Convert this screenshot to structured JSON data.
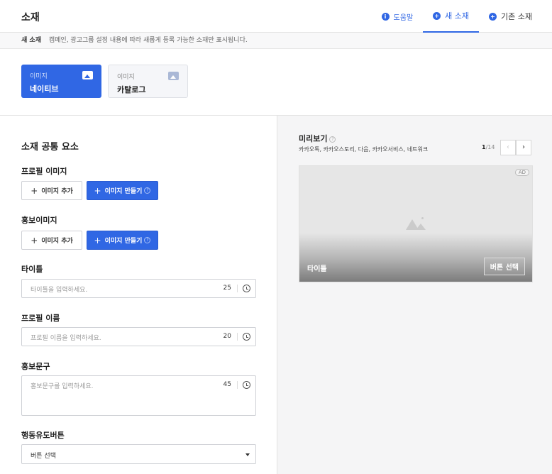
{
  "header": {
    "title": "소재",
    "tabs": [
      {
        "label": "도움말"
      },
      {
        "label": "새 소재"
      },
      {
        "label": "기존 소재"
      }
    ]
  },
  "subbar": {
    "title": "새 소재",
    "desc": "캠페인, 광고그룹 설정 내용에 따라 새롭게 등록 가능한 소재만 표시됩니다."
  },
  "types": [
    {
      "caption": "이미지",
      "name": "네이티브",
      "selected": true
    },
    {
      "caption": "이미지",
      "name": "카탈로그",
      "selected": false
    }
  ],
  "form": {
    "section_title": "소재 공통 요소",
    "profile_image": {
      "label": "프로필 이미지",
      "add": "이미지 추가",
      "create": "이미지 만들기"
    },
    "promo_image": {
      "label": "홍보이미지",
      "add": "이미지 추가",
      "create": "이미지 만들기"
    },
    "title": {
      "label": "타이틀",
      "placeholder": "타이틀을 입력하세요.",
      "max": "25"
    },
    "profile_name": {
      "label": "프로필 이름",
      "placeholder": "프로필 이름을 입력하세요.",
      "max": "20"
    },
    "promo_text": {
      "label": "홍보문구",
      "placeholder": "홍보문구를 입력하세요.",
      "max": "45"
    },
    "cta": {
      "label": "행동유도버튼",
      "value": "버튼 선택"
    }
  },
  "preview": {
    "title": "미리보기",
    "platforms": "카카오톡, 카카오스토리, 다음, 카카오서비스, 네트워크",
    "page_current": "1",
    "page_total": "/14",
    "ad_badge": "AD",
    "card_title": "타이틀",
    "card_button": "버튼 선택"
  },
  "colors": {
    "accent": "#3067e4"
  }
}
